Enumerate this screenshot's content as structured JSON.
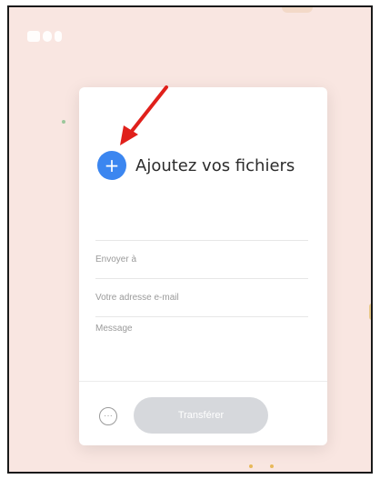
{
  "upload": {
    "add_label": "Ajoutez vos fichiers",
    "plus_symbol": "+"
  },
  "form": {
    "to_placeholder": "Envoyer à",
    "email_placeholder": "Votre adresse e-mail",
    "message_placeholder": "Message"
  },
  "actions": {
    "more_symbol": "···",
    "transfer_label": "Transférer"
  },
  "colors": {
    "background": "#f9e6e1",
    "accent": "#3b86f0",
    "annotation_arrow": "#e0201b",
    "button_disabled": "#d6d8dc"
  },
  "icons": {
    "logo": "brand-logo",
    "plus": "plus-icon",
    "more": "more-options-icon",
    "arrow": "annotation-arrow-icon"
  }
}
